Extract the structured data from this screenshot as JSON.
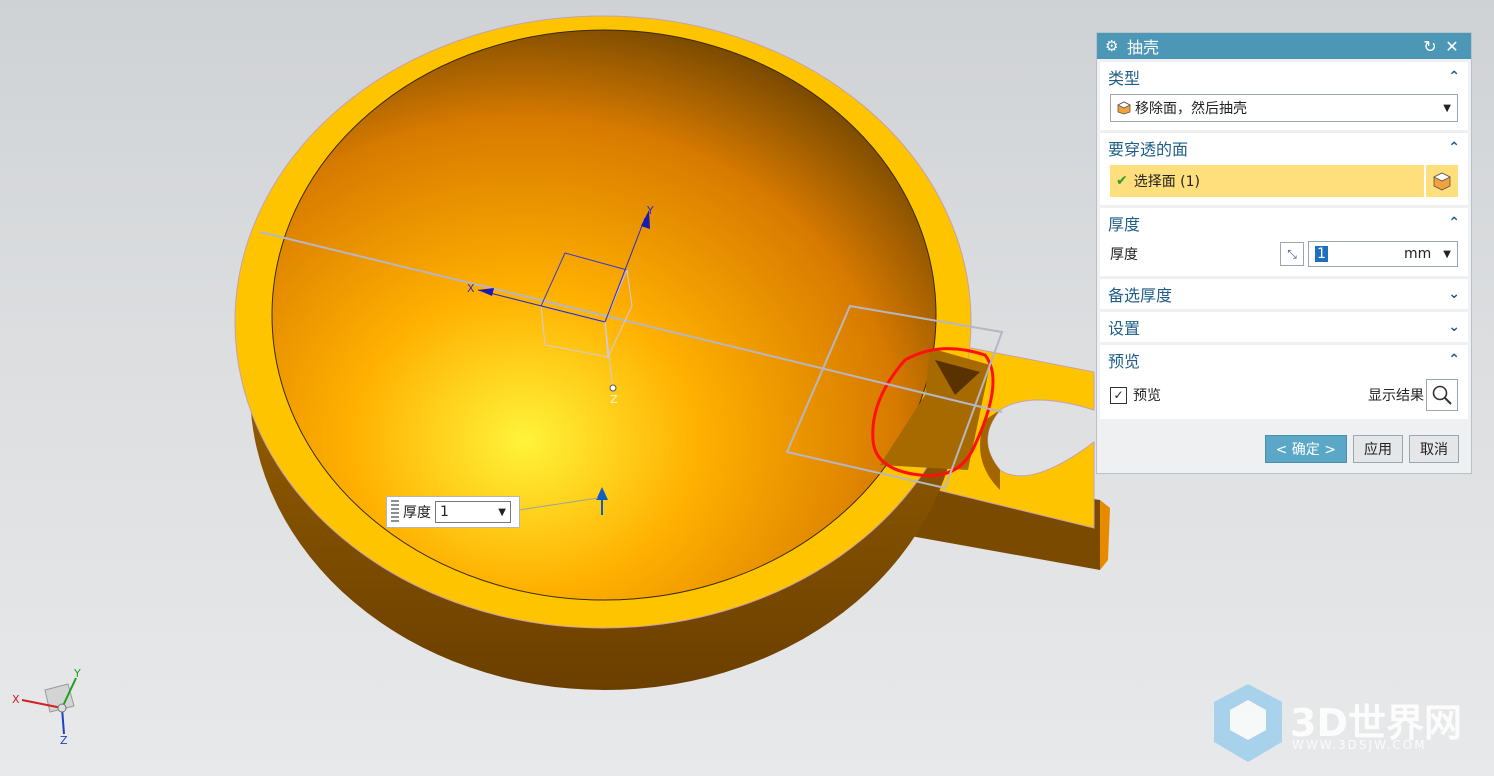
{
  "dialog": {
    "title": "抽壳",
    "sections": {
      "type": {
        "label": "类型",
        "dropdown_value": "移除面，然后抽壳"
      },
      "pierce_faces": {
        "label": "要穿透的面",
        "select_label": "选择面 (1)"
      },
      "thickness": {
        "label": "厚度",
        "field_label": "厚度",
        "value": "1",
        "unit": "mm"
      },
      "alt_thickness": {
        "label": "备选厚度"
      },
      "settings": {
        "label": "设置"
      },
      "preview": {
        "label": "预览",
        "checkbox_label": "预览",
        "show_result_label": "显示结果"
      }
    },
    "buttons": {
      "ok": "< 确定 >",
      "apply": "应用",
      "cancel": "取消"
    }
  },
  "floating_input": {
    "label": "厚度",
    "value": "1"
  },
  "csys_labels": {
    "x": "X",
    "y": "Y",
    "z": "Z"
  },
  "watermark": {
    "text": "3D世界网",
    "url": "WWW.3DSJW.COM"
  },
  "colors": {
    "titlebar": "#4d97b6",
    "model": "#ffc400",
    "highlight": "#fedf7c"
  }
}
